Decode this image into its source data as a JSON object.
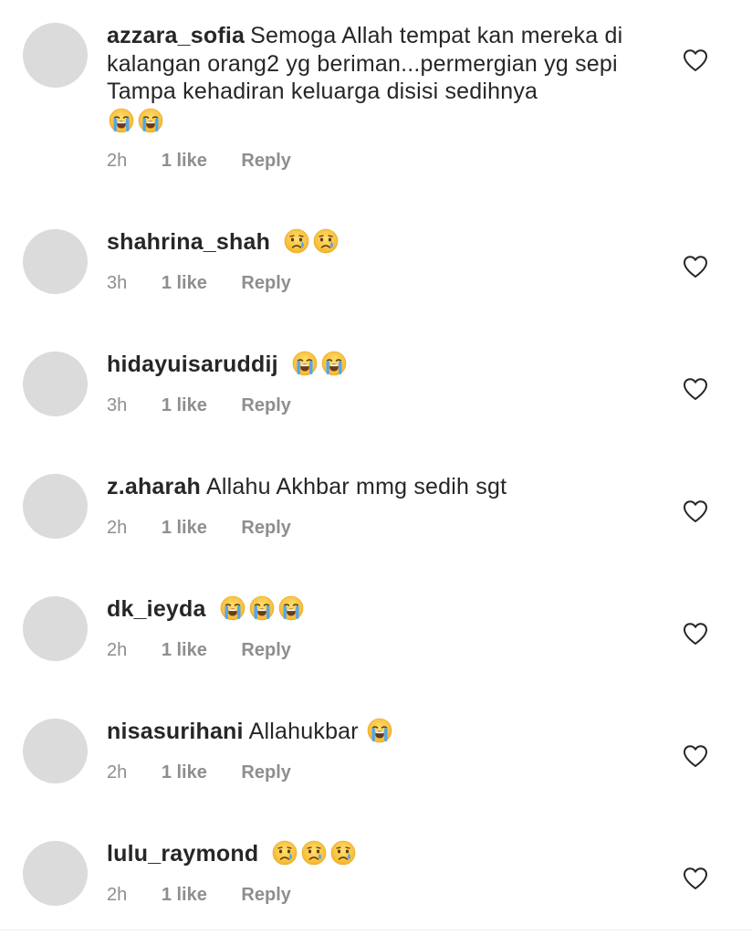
{
  "icons": {
    "heart": "heart-outline-icon",
    "crying_loud": "loudly-crying-face-emoji",
    "crying": "crying-face-emoji"
  },
  "colors": {
    "username": "#262626",
    "meta": "#8e8e8e",
    "avatar_placeholder": "#dbdbdb"
  },
  "comments": [
    {
      "username": "azzara_sofia",
      "text": "Semoga Allah tempat kan mereka di kalangan orang2 yg beriman...permergian yg sepi Tampa kehadiran keluarga disisi sedihnya",
      "emojis": [
        "crying_loud",
        "crying_loud"
      ],
      "time": "2h",
      "likes": "1 like",
      "reply": "Reply"
    },
    {
      "username": "shahrina_shah",
      "text": "",
      "emojis": [
        "crying",
        "crying"
      ],
      "time": "3h",
      "likes": "1 like",
      "reply": "Reply"
    },
    {
      "username": "hidayuisaruddij",
      "text": "",
      "emojis": [
        "crying_loud",
        "crying_loud"
      ],
      "time": "3h",
      "likes": "1 like",
      "reply": "Reply"
    },
    {
      "username": "z.aharah",
      "text": "Allahu Akhbar mmg sedih sgt",
      "emojis": [],
      "time": "2h",
      "likes": "1 like",
      "reply": "Reply"
    },
    {
      "username": "dk_ieyda",
      "text": "",
      "emojis": [
        "crying_loud",
        "crying_loud",
        "crying_loud"
      ],
      "time": "2h",
      "likes": "1 like",
      "reply": "Reply"
    },
    {
      "username": "nisasurihani",
      "text": "Allahukbar",
      "emojis": [
        "crying_loud"
      ],
      "time": "2h",
      "likes": "1 like",
      "reply": "Reply"
    },
    {
      "username": "lulu_raymond",
      "text": "",
      "emojis": [
        "crying",
        "crying",
        "crying"
      ],
      "time": "2h",
      "likes": "1 like",
      "reply": "Reply"
    }
  ]
}
